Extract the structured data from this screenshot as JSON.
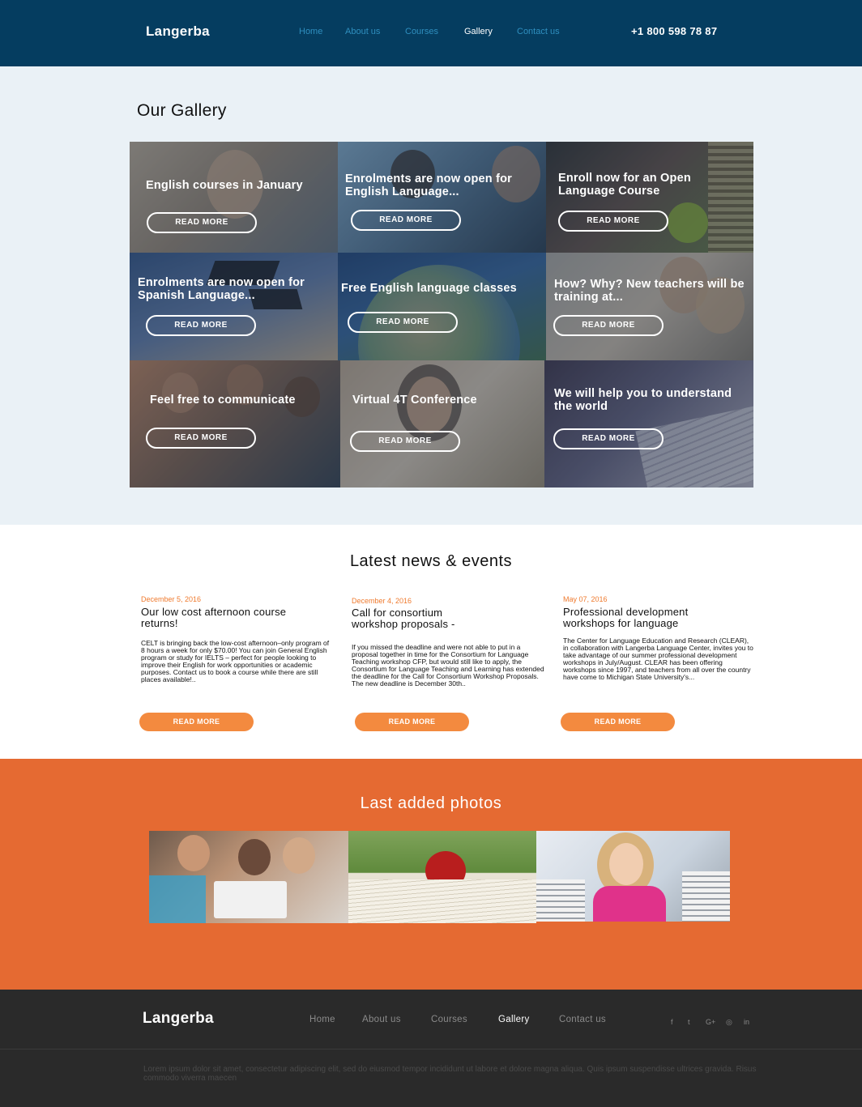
{
  "header": {
    "logo": "Langerba",
    "nav": [
      {
        "label": "Home",
        "active": false
      },
      {
        "label": "About us",
        "active": false
      },
      {
        "label": "Courses",
        "active": false
      },
      {
        "label": "Gallery",
        "active": true
      },
      {
        "label": "Contact us",
        "active": false
      }
    ],
    "phone": "+1 800 598 78 87"
  },
  "gallery": {
    "title": "Our Gallery",
    "button_label": "READ MORE",
    "items": [
      {
        "caption": "English courses in January"
      },
      {
        "caption": "Enrolments are now open for English Language..."
      },
      {
        "caption": "Enroll now for an Open Language Course"
      },
      {
        "caption": "Enrolments are now open for Spanish Language..."
      },
      {
        "caption": "Free English language classes"
      },
      {
        "caption": "How? Why? New teachers will be training at..."
      },
      {
        "caption": "Feel free to communicate"
      },
      {
        "caption": "Virtual 4T Conference"
      },
      {
        "caption": "We will help you to understand the world"
      }
    ]
  },
  "news": {
    "title": "Latest news & events",
    "button_label": "READ MORE",
    "items": [
      {
        "date": "December 5, 2016",
        "title": "Our low cost afternoon course returns!",
        "body": "CELT is bringing back the low-cost afternoon–only program of 8 hours a week for only $70.00! You can join General English program or study for IELTS – perfect for people looking to improve their English for work opportunities or academic purposes. Contact us to book a course while there are still places available!.."
      },
      {
        "date": "December 4, 2016",
        "title": "Call for consortium workshop proposals -",
        "body": "If you missed the deadline and were not able to put in a proposal together in time for the Consortium for Language Teaching workshop CFP, but would still like to apply, the Consortium for Language Teaching and Learning has extended the deadline for the Call for Consortium Workshop Proposals. The new deadline is December 30th.."
      },
      {
        "date": "May 07, 2016",
        "title": "Professional development workshops for language",
        "body": "The Center for Language Education and Research (CLEAR), in collaboration with Langerba Language Center, invites you to take advantage of our summer professional development workshops in July/August. CLEAR has been offering workshops since 1997, and teachers from all over the country have come to Michigan State University's..."
      }
    ]
  },
  "photos": {
    "title": "Last added photos"
  },
  "footer": {
    "logo": "Langerba",
    "nav": [
      {
        "label": "Home",
        "active": false
      },
      {
        "label": "About us",
        "active": false
      },
      {
        "label": "Courses",
        "active": false
      },
      {
        "label": "Gallery",
        "active": true
      },
      {
        "label": "Contact us",
        "active": false
      }
    ],
    "social": [
      "f",
      "t",
      "G+",
      "◎",
      "in"
    ],
    "social_icons": [
      "facebook-icon",
      "twitter-icon",
      "google-plus-icon",
      "instagram-icon",
      "linkedin-icon"
    ],
    "text": "Lorem ipsum dolor sit amet, consectetur adipiscing elit, sed do eiusmod tempor incididunt ut labore et dolore magna aliqua. Quis ipsum suspendisse ultrices gravida. Risus commodo viverra maecen"
  },
  "colors": {
    "header_bg": "#053d60",
    "accent_orange": "#e56a32",
    "button_orange": "#f38a3f",
    "date_orange": "#ef7a2e",
    "footer_bg": "#2a2a2a"
  }
}
